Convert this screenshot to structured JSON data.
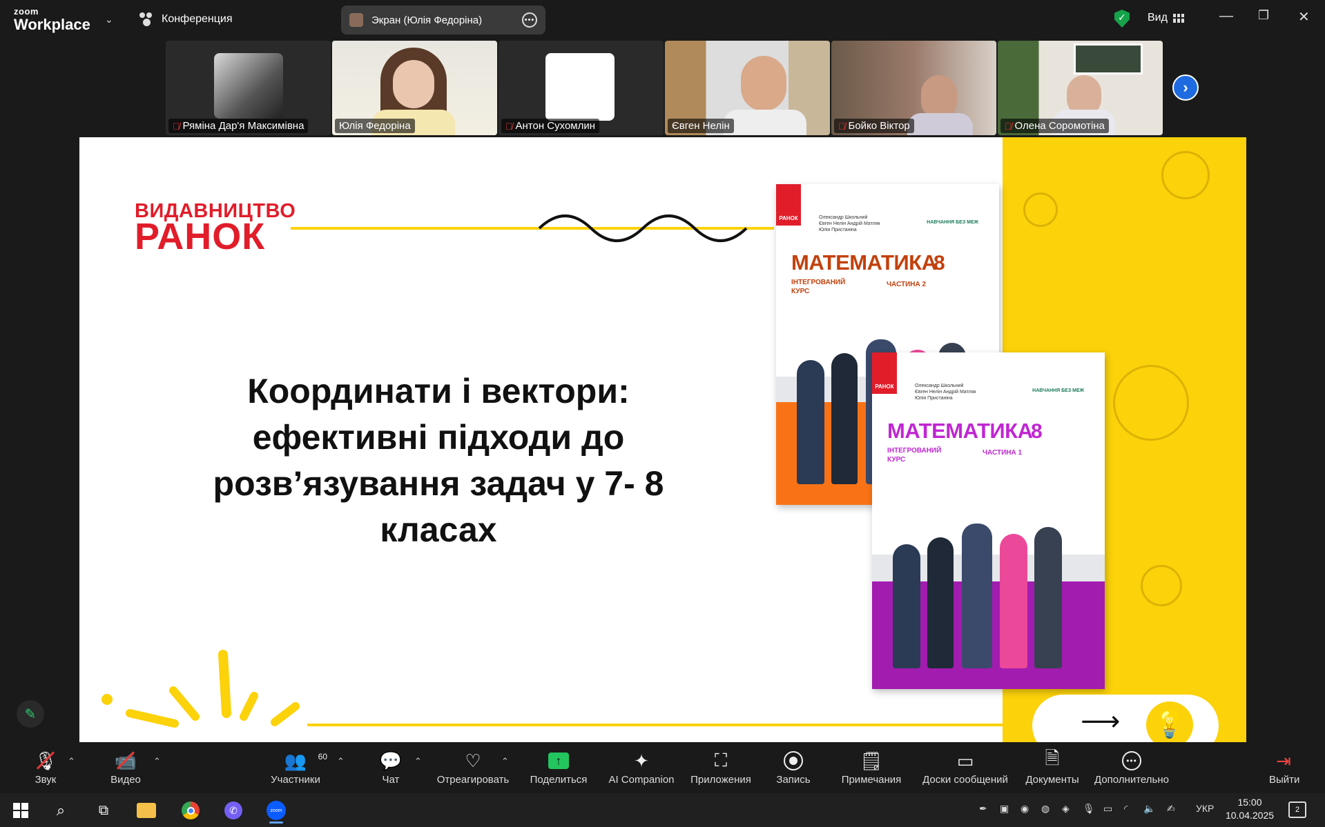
{
  "titlebar": {
    "brand_small": "zoom",
    "brand_large": "Workplace",
    "conference_label": "Конференция",
    "share_label": "Экран (Юлія Федоріна)",
    "view_label": "Вид"
  },
  "participants": [
    {
      "name": "Ряміна Дар'я Максимівна",
      "muted": true
    },
    {
      "name": "Юлія Федоріна",
      "muted": false,
      "active": true
    },
    {
      "name": "Антон Сухомлин",
      "muted": true
    },
    {
      "name": "Євген Нелін",
      "muted": false
    },
    {
      "name": "Бойко Віктор",
      "muted": true
    },
    {
      "name": "Олена Соромотіна",
      "muted": true
    }
  ],
  "slide": {
    "logo_line1": "ВИДАВНИЦТВО",
    "logo_line2": "РАНОК",
    "title": "Координати і вектори: ефективні підходи до розв’язування задач у 7- 8 класах",
    "book_back": {
      "title": "МАТЕМАТИКА",
      "grade": "8",
      "course": "ІНТЕГРОВАНИЙ КУРС",
      "part": "ЧАСТИНА 2",
      "publisher": "РАНОК",
      "authors": "Олександр Школьний Євген Нелін Андрій Матляк Юлія Пристаніна",
      "badge": "НАВЧАННЯ БЕЗ МЕЖ",
      "band_color": "#f97316"
    },
    "book_front": {
      "title": "МАТЕМАТИКА",
      "grade": "8",
      "course": "ІНТЕГРОВАНИЙ КУРС",
      "part": "ЧАСТИНА 1",
      "publisher": "РАНОК",
      "authors": "Олександр Школьний Євген Нелін Андрій Матляк Юлія Пристаніна",
      "badge": "НАВЧАННЯ БЕЗ МЕЖ",
      "band_color": "#a21caf"
    },
    "arrow": "⟶",
    "bulb_icon": "lightbulb-icon"
  },
  "toolbar": {
    "audio": "Звук",
    "video": "Видео",
    "participants": "Участники",
    "participants_count": "60",
    "chat": "Чат",
    "react": "Отреагировать",
    "share": "Поделиться",
    "ai": "AI Companion",
    "apps": "Приложения",
    "record": "Запись",
    "notes": "Примечания",
    "whiteboards": "Доски сообщений",
    "docs": "Документы",
    "more": "Дополнительно",
    "leave": "Выйти"
  },
  "taskbar": {
    "lang": "УКР",
    "time": "15:00",
    "date": "10.04.2025",
    "notifications": "2"
  },
  "colors": {
    "accent_yellow": "#fcd20a",
    "brand_red": "#e11d2a",
    "active_green": "#2ecc71",
    "zoom_blue": "#1e6ae0"
  }
}
